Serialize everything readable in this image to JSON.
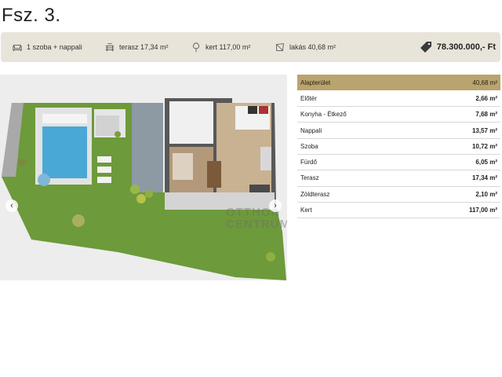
{
  "title": "Fsz. 3.",
  "summary": {
    "rooms": "1 szoba + nappali",
    "terrace": "terasz 17,34 m²",
    "garden": "kert 117,00 m²",
    "flat": "lakás 40,68 m²",
    "price": "78.300.000,- Ft",
    "icons": [
      "sofa-icon",
      "terrace-icon",
      "tree-icon",
      "floor-area-icon",
      "price-tag-icon"
    ]
  },
  "plan": {
    "watermark_line1": "OTTHON",
    "watermark_line2": "CENTRUM",
    "nav_prev": "‹",
    "nav_next": "›"
  },
  "areas": [
    {
      "name": "Alapterület",
      "value": "40,68 m²"
    },
    {
      "name": "Előtér",
      "value": "2,66 m²"
    },
    {
      "name": "Konyha - Étkező",
      "value": "7,68 m²"
    },
    {
      "name": "Nappali",
      "value": "13,57 m²"
    },
    {
      "name": "Szoba",
      "value": "10,72 m²"
    },
    {
      "name": "Fürdő",
      "value": "6,05 m²"
    },
    {
      "name": "Terasz",
      "value": "17,34 m²"
    },
    {
      "name": "Zöldterasz",
      "value": "2,10 m²"
    },
    {
      "name": "Kert",
      "value": "117,00 m²"
    }
  ],
  "colors": {
    "accent": "#b9a46f",
    "bar": "#e9e4da",
    "grass": "#6d9a3a",
    "pool": "#4aa8d6"
  }
}
